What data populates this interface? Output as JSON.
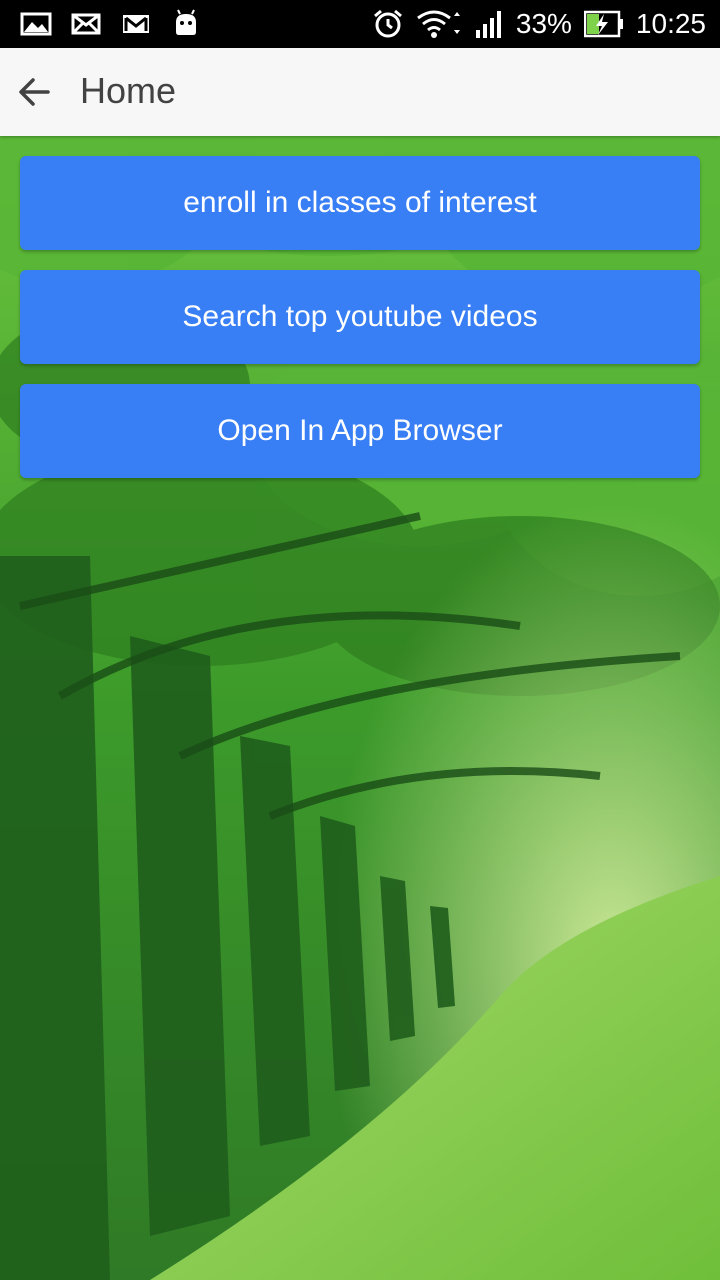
{
  "status_bar": {
    "left_icons": [
      "image-icon",
      "email-icon",
      "gmail-icon",
      "android-icon"
    ],
    "right_icons": [
      "alarm-icon",
      "wifi-icon",
      "signal-icon",
      "battery-charging-icon"
    ],
    "battery_percent": "33%",
    "time": "10:25"
  },
  "app_bar": {
    "title": "Home",
    "back_icon": "arrow-back-icon"
  },
  "buttons": [
    {
      "label": "enroll in classes of interest"
    },
    {
      "label": "Search top youtube videos"
    },
    {
      "label": "Open In App Browser"
    }
  ],
  "colors": {
    "button_bg": "#387ef5",
    "app_bar_bg": "#f7f7f7",
    "status_bar_bg": "#000000"
  }
}
